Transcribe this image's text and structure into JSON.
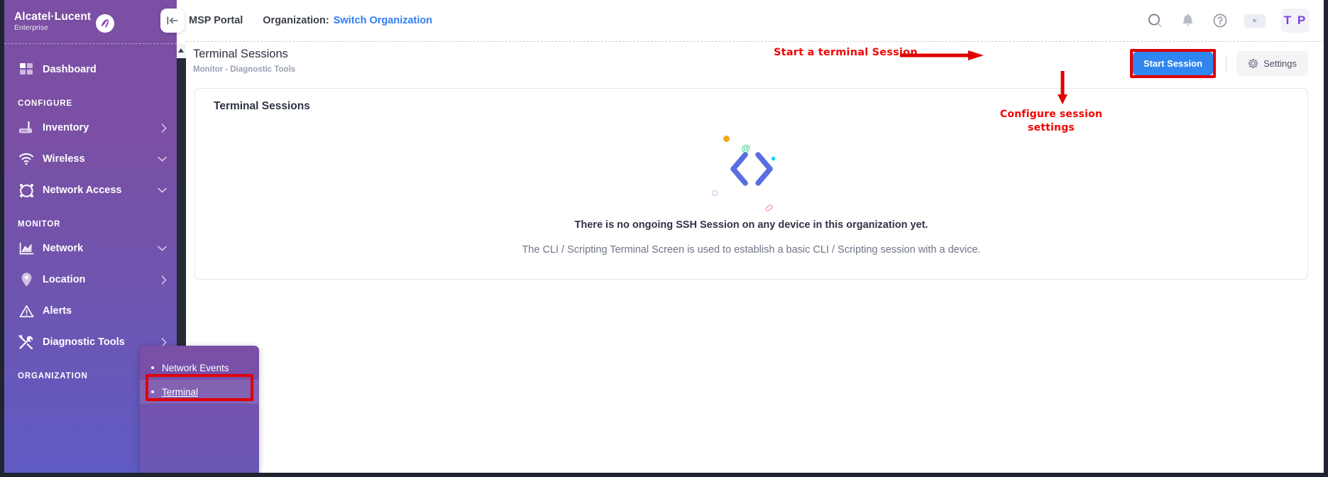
{
  "brand": {
    "name": "Alcatel·Lucent",
    "sub": "Enterprise",
    "logo_icon": "alcatel-swirl-icon"
  },
  "topbar": {
    "collapse_icon": "collapse-left-icon",
    "msp_portal": "MSP Portal",
    "organization_label": "Organization:",
    "switch_organization": "Switch Organization",
    "icons": [
      {
        "name": "search-icon",
        "glyph": "search"
      },
      {
        "name": "notification-bell-icon",
        "glyph": "bell"
      },
      {
        "name": "help-circle-icon",
        "glyph": "help"
      },
      {
        "name": "play-video-icon",
        "glyph": "play"
      }
    ],
    "avatar_initials": "T P"
  },
  "page": {
    "title": "Terminal Sessions",
    "breadcrumb": "Monitor  -  Diagnostic Tools",
    "start_session_label": "Start Session",
    "settings_label": "Settings",
    "settings_icon": "gear-icon"
  },
  "card": {
    "title": "Terminal Sessions",
    "empty_heading": "There is no ongoing SSH Session on any device in this organization yet.",
    "empty_sub": "The CLI / Scripting Terminal Screen is used to establish a basic CLI / Scripting session with a device.",
    "illustration_icon": "code-brackets-icon"
  },
  "annotations": {
    "start_session": "Start a terminal Session",
    "configure_settings": "Configure session settings",
    "color": "#f20000"
  },
  "sidebar": {
    "dashboard": {
      "label": "Dashboard",
      "icon": "dashboard-grid-icon"
    },
    "groups": [
      {
        "label": "CONFIGURE",
        "items": [
          {
            "label": "Inventory",
            "icon": "router-icon",
            "caret": "chevron-right-icon"
          },
          {
            "label": "Wireless",
            "icon": "wifi-icon",
            "caret": "chevron-down-icon"
          },
          {
            "label": "Network Access",
            "icon": "network-nodes-icon",
            "caret": "chevron-down-icon"
          }
        ]
      },
      {
        "label": "MONITOR",
        "items": [
          {
            "label": "Network",
            "icon": "chart-area-icon",
            "caret": "chevron-down-icon"
          },
          {
            "label": "Location",
            "icon": "map-pin-icon",
            "caret": "chevron-right-icon"
          },
          {
            "label": "Alerts",
            "icon": "warning-triangle-icon",
            "caret": ""
          },
          {
            "label": "Diagnostic Tools",
            "icon": "tools-icon",
            "caret": "chevron-right-icon"
          }
        ]
      },
      {
        "label": "ORGANIZATION",
        "items": []
      }
    ],
    "submenu": {
      "items": [
        {
          "label": "Network Events",
          "selected": false
        },
        {
          "label": "Terminal",
          "selected": true
        }
      ]
    }
  },
  "colors": {
    "sidebar_top": "#7B4FA3",
    "sidebar_bottom": "#5E5BC4",
    "accent_blue": "#2f86f0",
    "link_blue": "#2f7ef5",
    "annotation_red": "#f20000",
    "avatar_purple": "#7a41e0"
  }
}
